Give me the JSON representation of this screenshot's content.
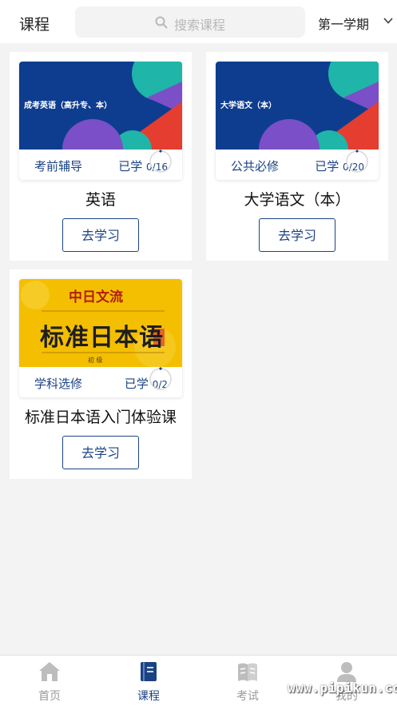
{
  "header": {
    "title": "课程",
    "search_placeholder": "搜索课程",
    "term": "第一学期"
  },
  "courses": [
    {
      "thumb_text": "成考英语（高升专、本）",
      "category": "考前辅导",
      "learned_label": "已学",
      "progress": "0/16",
      "name": "英语",
      "button": "去学习"
    },
    {
      "thumb_text": "大学语文（本）",
      "category": "公共必修",
      "learned_label": "已学",
      "progress": "0/20",
      "name": "大学语文（本）",
      "button": "去学习"
    },
    {
      "thumb_text_top": "中日文流",
      "thumb_text_main": "标准日本语",
      "thumb_text_sub": "初 级",
      "category": "学科选修",
      "learned_label": "已学",
      "progress": "0/2",
      "name": "标准日本语入门体验课",
      "button": "去学习"
    }
  ],
  "tabs": [
    {
      "label": "首页",
      "icon": "home-icon"
    },
    {
      "label": "课程",
      "icon": "book-icon"
    },
    {
      "label": "考试",
      "icon": "exam-icon"
    },
    {
      "label": "我的",
      "icon": "user-icon"
    }
  ],
  "watermark": "www.pipikun.com",
  "colors": {
    "accent": "#1b4384",
    "thumb_blue": "#0e3d8f",
    "thumb_teal": "#1fb5a8",
    "thumb_purple": "#7a4fc8",
    "thumb_red": "#e53d2f",
    "thumb_yellow": "#f6c400"
  }
}
